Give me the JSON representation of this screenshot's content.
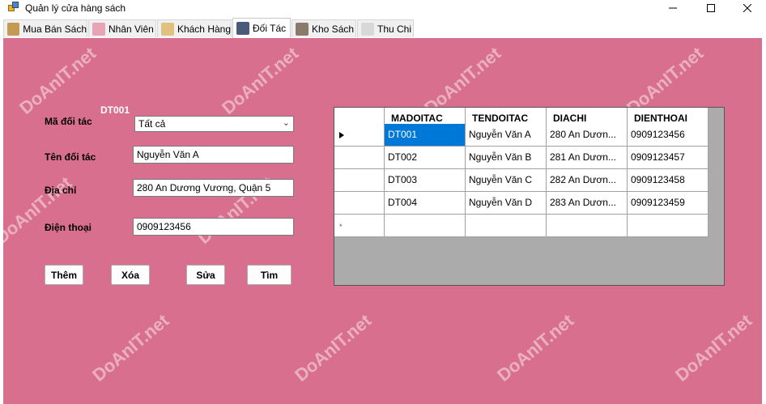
{
  "window": {
    "title": "Quản lý cửa hàng sách"
  },
  "tabs": [
    {
      "label": "Mua Bán Sách",
      "icon": "book-icon",
      "color": "#c49a52"
    },
    {
      "label": "Nhân Viên",
      "icon": "person-icon",
      "color": "#e6a4b4"
    },
    {
      "label": "Khách Hàng",
      "icon": "customer-icon",
      "color": "#e0c280"
    },
    {
      "label": "Đối Tác",
      "icon": "partner-icon",
      "color": "#4a5a7a"
    },
    {
      "label": "Kho Sách",
      "icon": "warehouse-icon",
      "color": "#8a7a6a"
    },
    {
      "label": "Thu Chi",
      "icon": "money-icon",
      "color": "#d8d8d8"
    }
  ],
  "form": {
    "id_display": "DT001",
    "ma_doi_tac_label": "Mã đối tác",
    "ma_doi_tac_value": "Tất cả",
    "ten_doi_tac_label": "Tên đối tác",
    "ten_doi_tac_value": "Nguyễn Văn A",
    "dia_chi_label": "Địa chỉ",
    "dia_chi_value": "280 An Dương Vương, Quận 5",
    "dien_thoai_label": "Điện thoại",
    "dien_thoai_value": "0909123456"
  },
  "buttons": {
    "them": "Thêm",
    "xoa": "Xóa",
    "sua": "Sửa",
    "tim": "Tìm"
  },
  "grid": {
    "columns": [
      "MADOITAC",
      "TENDOITAC",
      "DIACHI",
      "DIENTHOAI"
    ],
    "rows": [
      [
        "DT001",
        "Nguyễn Văn A",
        "280 An Dươn...",
        "0909123456"
      ],
      [
        "DT002",
        "Nguyễn Văn B",
        "281 An Dươn...",
        "0909123457"
      ],
      [
        "DT003",
        "Nguyễn Văn C",
        "282 An Dươn...",
        "0909123458"
      ],
      [
        "DT004",
        "Nguyễn Văn D",
        "283 An Dươn...",
        "0909123459"
      ]
    ]
  },
  "watermark": "DoAnIT.net",
  "colors": {
    "page_bg": "#d96f8f",
    "selection": "#0078d7"
  }
}
